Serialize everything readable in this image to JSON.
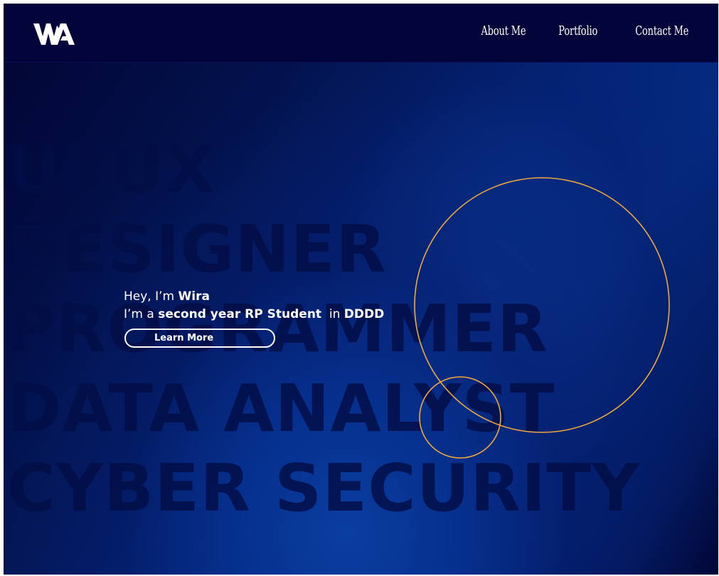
{
  "header": {
    "logo_text": "WA",
    "nav": [
      {
        "label": "About Me"
      },
      {
        "label": "Portfolio"
      },
      {
        "label": "Contact Me"
      }
    ]
  },
  "hero": {
    "roles": [
      "UI/UX",
      "DESIGNER",
      "PROGRAMMER",
      "DATA ANALYST",
      "CYBER SECURITY"
    ],
    "greeting_prefix": "Hey, I’m ",
    "name": "Wira",
    "line2_prefix": "I’m a ",
    "status": "second year RP Student",
    "line2_mid": "  in ",
    "course": "DDDD",
    "cta_label": "Learn More"
  },
  "colors": {
    "navbar": "#03053a",
    "hero_accent": "#0a3ea0",
    "circle_stroke": "#f0a93a",
    "text": "#ffffff"
  }
}
